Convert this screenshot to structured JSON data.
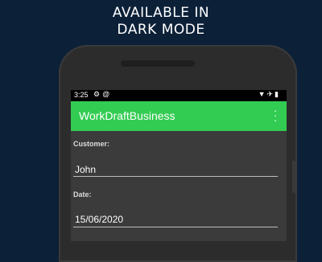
{
  "headline": {
    "line1": "AVAILABLE IN",
    "line2": "DARK MODE"
  },
  "status_bar": {
    "time": "3:25",
    "left_icons": [
      "gear-icon",
      "at-sign-icon"
    ],
    "right_icons": [
      "wifi-icon",
      "airplane-icon",
      "battery-icon"
    ]
  },
  "app_bar": {
    "title": "WorkDraftBusiness",
    "color": "#33cc52"
  },
  "form": {
    "customer_label": "Customer:",
    "customer_value": "John",
    "date_label": "Date:",
    "date_value": "15/06/2020"
  },
  "colors": {
    "background": "#0c2138",
    "screen": "#3b3b3b",
    "accent": "#33cc52"
  }
}
